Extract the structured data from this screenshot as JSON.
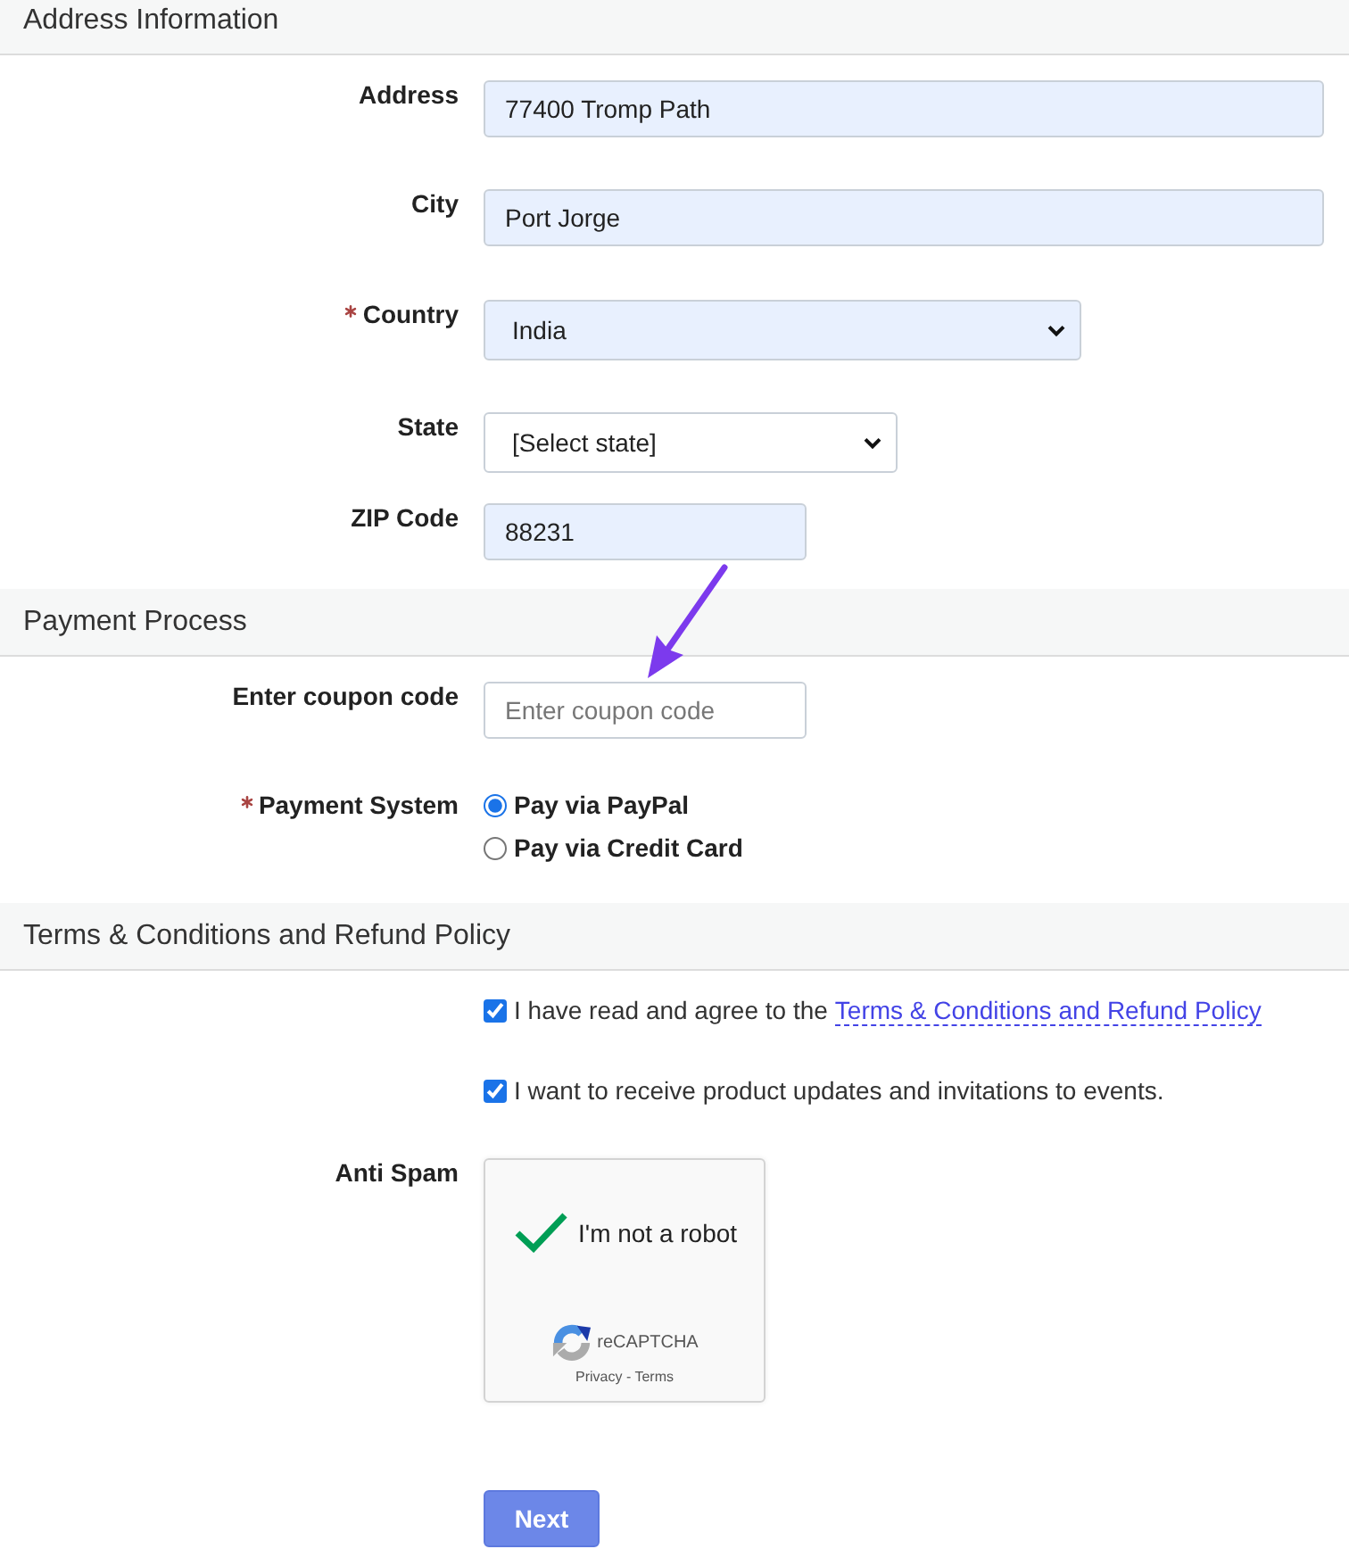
{
  "sections": [
    {
      "title": "Address Information",
      "rows": [
        {
          "kind": "text",
          "label": "Address",
          "required": false,
          "value": "77400 Tromp Path",
          "autofilled": true
        },
        {
          "kind": "text",
          "label": "City",
          "required": false,
          "value": "Port Jorge",
          "autofilled": true
        },
        {
          "kind": "select",
          "label": "Country",
          "required": true,
          "value": "India",
          "autofilled": true
        },
        {
          "kind": "select",
          "label": "State",
          "required": false,
          "value": "[Select state]",
          "autofilled": false
        },
        {
          "kind": "text",
          "label": "ZIP Code",
          "required": false,
          "value": "88231",
          "autofilled": true
        }
      ]
    },
    {
      "title": "Payment Process",
      "rows": [
        {
          "kind": "text",
          "label": "Enter coupon code",
          "required": false,
          "placeholder": "Enter coupon code",
          "autofilled": false
        },
        {
          "kind": "radio",
          "label": "Payment System",
          "required": true,
          "options": [
            {
              "label": "Pay via PayPal",
              "selected": true
            },
            {
              "label": "Pay via Credit Card",
              "selected": false
            }
          ]
        }
      ]
    },
    {
      "title": "Terms & Conditions and Refund Policy",
      "rows": [
        {
          "kind": "checkbox",
          "text": "I have read and agree to the",
          "link": "Terms & Conditions and Refund Policy",
          "checked": true
        },
        {
          "kind": "checkbox",
          "text": "I want to receive product updates and invitations to events.",
          "checked": true
        },
        {
          "kind": "captcha",
          "label": "Anti Spam",
          "required": false,
          "checked": true,
          "text": "I'm not a robot",
          "brand": "reCAPTCHA",
          "footer": "Privacy - Terms"
        }
      ]
    }
  ],
  "next_button": {
    "label": "Next"
  }
}
